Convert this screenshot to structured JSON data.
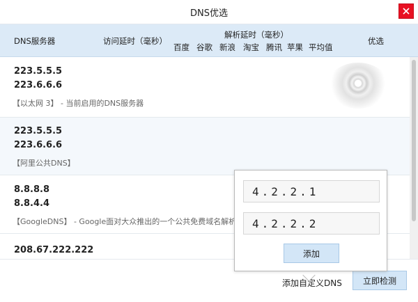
{
  "window": {
    "title": "DNS优选"
  },
  "header": {
    "server_col": "DNS服务器",
    "access_delay_col": "访问延时（毫秒）",
    "resolve_delay_col": "解析延时（毫秒）",
    "resolve_sites": [
      "百度",
      "谷歌",
      "新浪",
      "淘宝",
      "腾讯",
      "苹果",
      "平均值"
    ],
    "optimal_col": "优选"
  },
  "dns_list": [
    {
      "primary": "223.5.5.5",
      "secondary": "223.6.6.6",
      "description": "【以太网 3】 - 当前启用的DNS服务器"
    },
    {
      "primary": "223.5.5.5",
      "secondary": "223.6.6.6",
      "description": "【阿里公共DNS】"
    },
    {
      "primary": "8.8.8.8",
      "secondary": "8.8.4.4",
      "description": "【GoogleDNS】 - Google面对大众推出的一个公共免费域名解析"
    },
    {
      "primary": "208.67.222.222",
      "secondary": "",
      "description": ""
    }
  ],
  "custom_dns_popup": {
    "primary_value": "4.2.2.1",
    "secondary_value": "4.2.2.2",
    "add_label": "添加"
  },
  "footer": {
    "add_custom_label": "添加自定义DNS",
    "detect_label": "立即检测"
  },
  "colors": {
    "header_bg": "#dceaf7",
    "button_bg": "#d3e6f7",
    "close_red": "#e81123"
  }
}
